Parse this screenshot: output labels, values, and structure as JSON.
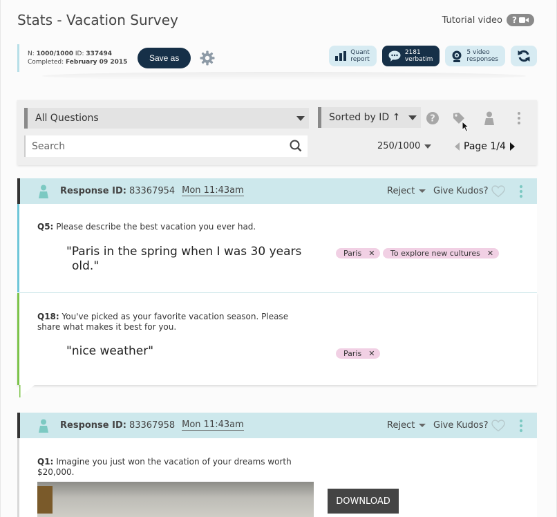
{
  "title": "Stats - Vacation Survey",
  "tutorial": {
    "label": "Tutorial video"
  },
  "meta": {
    "n_label": "N:",
    "n_value": "1000/1000",
    "id_label": "ID:",
    "id_value": "337494",
    "completed_label": "Completed:",
    "completed_value": "February 09 2015"
  },
  "toolbar": {
    "save_label": "Save as",
    "quant": {
      "line1": "Quant",
      "line2": "report"
    },
    "verbatim": {
      "line1": "2181",
      "line2": "verbatim"
    },
    "video": {
      "line1": "5 video",
      "line2": "responses"
    }
  },
  "filters": {
    "questions_selected": "All Questions",
    "sort_selected": "Sorted by ID ↑",
    "search_placeholder": "Search",
    "count": "250/1000",
    "page": "Page 1/4"
  },
  "responses": [
    {
      "id_label": "Response ID:",
      "id_value": "83367954",
      "time": "Mon 11:43am",
      "reject_label": "Reject",
      "kudos_label": "Give Kudos?",
      "questions": [
        {
          "q_label": "Q5:",
          "q_text": "Please describe the best vacation you ever had.",
          "answer_line1": "\"Paris in the spring when I was 30 years",
          "answer_line2": "old.\"",
          "tags": [
            "Paris",
            "To explore new cultures"
          ],
          "accent": "#6ec6d8"
        },
        {
          "q_label": "Q18:",
          "q_text_line1": "You've picked as your favorite vacation season. Please",
          "q_text_line2": "share what makes it best for you.",
          "answer_line1": "\"nice weather\"",
          "tags": [
            "Paris"
          ],
          "accent": "#7cc34a"
        }
      ]
    },
    {
      "id_label": "Response ID:",
      "id_value": "83367958",
      "time": "Mon 11:43am",
      "reject_label": "Reject",
      "kudos_label": "Give Kudos?",
      "questions": [
        {
          "q_label": "Q1:",
          "q_text_line1": "Imagine you just won the vacation of your dreams worth",
          "q_text_line2": "$20,000.",
          "download_label": "DOWNLOAD"
        }
      ]
    }
  ],
  "colors": {
    "header_bg": "#cde8ec",
    "dark_navy": "#163048",
    "tag_pink": "#f1d0e4",
    "pill_blue": "#d7ebf2"
  },
  "icons": [
    "help-icon",
    "video-camera-icon",
    "gear-icon",
    "bar-chart-icon",
    "speech-bubble-icon",
    "webcam-icon",
    "refresh-icon",
    "tag-icon",
    "person-icon",
    "kebab-icon",
    "search-icon",
    "heart-icon"
  ]
}
